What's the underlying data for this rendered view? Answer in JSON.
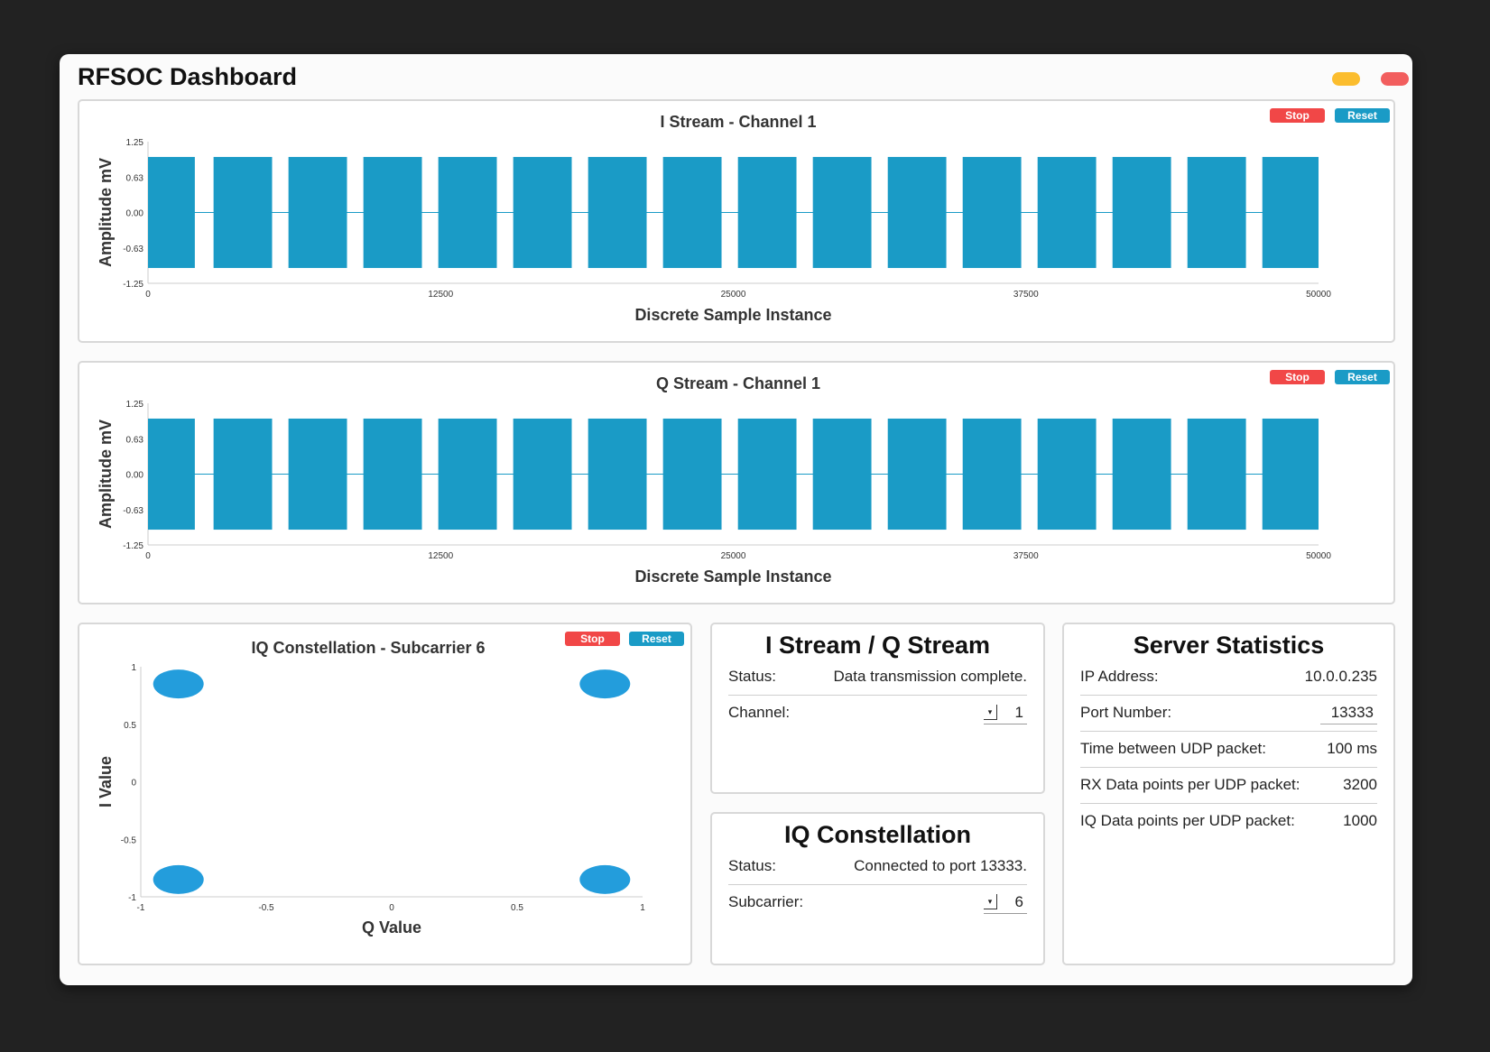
{
  "app": {
    "title": "RFSOC Dashboard"
  },
  "window_controls": {
    "minimize_color": "#fbbd2e",
    "close_color": "#f25e5e"
  },
  "buttons": {
    "stop_label": "Stop",
    "reset_label": "Reset"
  },
  "colors": {
    "signal": "#1a9bc6",
    "constellation": "#239ddc",
    "stop": "#f14747",
    "reset": "#1a9bc6"
  },
  "i_stream": {
    "title": "I Stream - Channel 1"
  },
  "q_stream": {
    "title": "Q Stream - Channel 1"
  },
  "constellation": {
    "title": "IQ Constellation - Subcarrier 6"
  },
  "chart_data": [
    {
      "type": "line",
      "title": "I Stream - Channel 1",
      "xlabel": "Discrete Sample Instance",
      "ylabel": "Amplitude mV",
      "xlim": [
        0,
        50000
      ],
      "ylim": [
        -1.25,
        1.25
      ],
      "x_ticks": [
        "0",
        "12500",
        "25000",
        "37500",
        "50000"
      ],
      "y_ticks": [
        "1.25",
        "0.63",
        "0.00",
        "-0.63",
        "-1.25"
      ],
      "burst_amplitude": [
        -0.98,
        0.98
      ],
      "burst_count": 16,
      "bursts": [
        [
          0,
          2000
        ],
        [
          2800,
          5300
        ],
        [
          6000,
          8500
        ],
        [
          9200,
          11700
        ],
        [
          12400,
          14900
        ],
        [
          15600,
          18100
        ],
        [
          18800,
          21300
        ],
        [
          22000,
          24500
        ],
        [
          25200,
          27700
        ],
        [
          28400,
          30900
        ],
        [
          31600,
          34100
        ],
        [
          34800,
          37300
        ],
        [
          38000,
          40500
        ],
        [
          41200,
          43700
        ],
        [
          44400,
          46900
        ],
        [
          47600,
          50000
        ]
      ]
    },
    {
      "type": "line",
      "title": "Q Stream - Channel 1",
      "xlabel": "Discrete Sample Instance",
      "ylabel": "Amplitude mV",
      "xlim": [
        0,
        50000
      ],
      "ylim": [
        -1.25,
        1.25
      ],
      "x_ticks": [
        "0",
        "12500",
        "25000",
        "37500",
        "50000"
      ],
      "y_ticks": [
        "1.25",
        "0.63",
        "0.00",
        "-0.63",
        "-1.25"
      ],
      "burst_amplitude": [
        -0.98,
        0.98
      ],
      "burst_count": 16,
      "bursts": [
        [
          0,
          2000
        ],
        [
          2800,
          5300
        ],
        [
          6000,
          8500
        ],
        [
          9200,
          11700
        ],
        [
          12400,
          14900
        ],
        [
          15600,
          18100
        ],
        [
          18800,
          21300
        ],
        [
          22000,
          24500
        ],
        [
          25200,
          27700
        ],
        [
          28400,
          30900
        ],
        [
          31600,
          34100
        ],
        [
          34800,
          37300
        ],
        [
          38000,
          40500
        ],
        [
          41200,
          43700
        ],
        [
          44400,
          46900
        ],
        [
          47600,
          50000
        ]
      ]
    },
    {
      "type": "scatter",
      "title": "IQ Constellation - Subcarrier 6",
      "xlabel": "Q Value",
      "ylabel": "I Value",
      "xlim": [
        -1,
        1
      ],
      "ylim": [
        -1,
        1
      ],
      "x_ticks": [
        "-1",
        "-0.5",
        "0",
        "0.5",
        "1"
      ],
      "y_ticks": [
        "1",
        "0.5",
        "0",
        "-0.5",
        "-1"
      ],
      "points": [
        {
          "x": -0.85,
          "y": 0.85
        },
        {
          "x": 0.85,
          "y": 0.85
        },
        {
          "x": -0.85,
          "y": -0.85
        },
        {
          "x": 0.85,
          "y": -0.85
        }
      ]
    }
  ],
  "stream_info": {
    "title": "I Stream / Q Stream",
    "status_label": "Status:",
    "status_value": "Data transmission complete.",
    "channel_label": "Channel:",
    "channel_value": "1"
  },
  "iq_info": {
    "title": "IQ Constellation",
    "status_label": "Status:",
    "status_value": "Connected to port 13333.",
    "subcarrier_label": "Subcarrier:",
    "subcarrier_value": "6"
  },
  "server_stats": {
    "title": "Server Statistics",
    "rows": [
      {
        "label": "IP Address:",
        "value": "10.0.0.235"
      },
      {
        "label": "Port Number:",
        "value": "13333"
      },
      {
        "label": "Time between UDP packet:",
        "value": "100 ms"
      },
      {
        "label": "RX Data points per UDP packet:",
        "value": "3200"
      },
      {
        "label": "IQ Data points per UDP packet:",
        "value": "1000"
      }
    ]
  }
}
